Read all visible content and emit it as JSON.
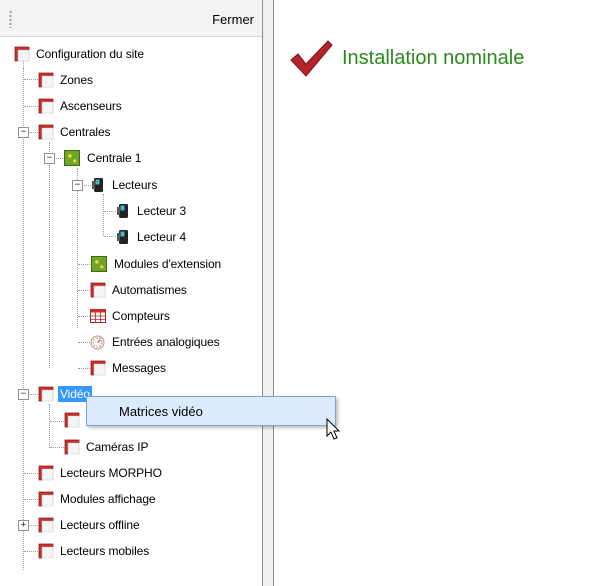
{
  "panel": {
    "close_label": "Fermer"
  },
  "status": {
    "text": "Installation nominale",
    "color": "#2a8a1c",
    "icon": "checkmark-icon"
  },
  "tree": [
    {
      "label": "Configuration du site",
      "icon": "folder-icon"
    },
    {
      "label": "Zones",
      "icon": "folder-icon"
    },
    {
      "label": "Ascenseurs",
      "icon": "folder-icon"
    },
    {
      "label": "Centrales",
      "icon": "folder-icon",
      "expanded": true
    },
    {
      "label": "Centrale 1",
      "icon": "controller-board-icon",
      "expanded": true
    },
    {
      "label": "Lecteurs",
      "icon": "card-reader-icon",
      "expanded": true
    },
    {
      "label": "Lecteur 3",
      "icon": "card-reader-icon"
    },
    {
      "label": "Lecteur 4",
      "icon": "card-reader-icon"
    },
    {
      "label": "Modules d'extension",
      "icon": "controller-board-icon"
    },
    {
      "label": "Automatismes",
      "icon": "folder-icon"
    },
    {
      "label": "Compteurs",
      "icon": "counter-grid-icon"
    },
    {
      "label": "Entrées analogiques",
      "icon": "gauge-icon"
    },
    {
      "label": "Messages",
      "icon": "folder-icon"
    },
    {
      "label": "Vidéo",
      "icon": "folder-icon",
      "expanded": true,
      "selected": true
    },
    {
      "label": "",
      "icon": "folder-icon"
    },
    {
      "label": "Caméras IP",
      "icon": "folder-icon"
    },
    {
      "label": "Lecteurs MORPHO",
      "icon": "folder-icon"
    },
    {
      "label": "Modules affichage",
      "icon": "folder-icon"
    },
    {
      "label": "Lecteurs offline",
      "icon": "folder-icon",
      "expanded": false
    },
    {
      "label": "Lecteurs mobiles",
      "icon": "folder-icon"
    }
  ],
  "context_menu": {
    "items": [
      {
        "label": "Matrices vidéo"
      }
    ]
  },
  "colors": {
    "selection": "#3399ff",
    "menu_bg": "#dcebfc",
    "menu_border": "#7ba3d6",
    "folder_red": "#c0392b"
  }
}
